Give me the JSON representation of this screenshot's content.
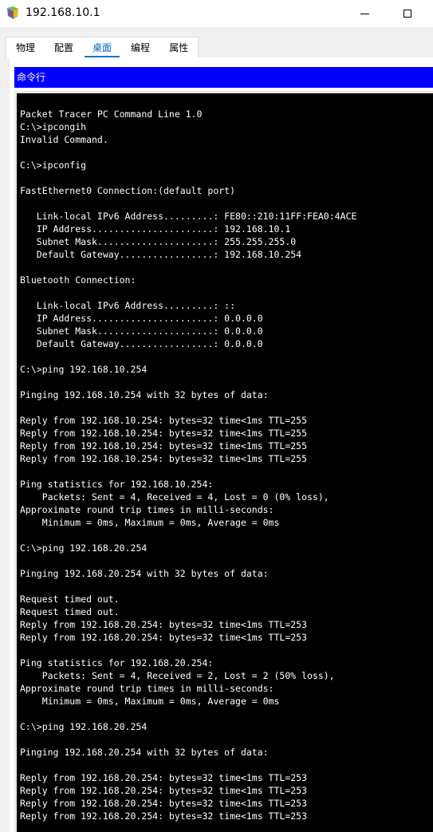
{
  "window": {
    "title": "192.168.10.1",
    "icon": "packet-tracer-icon",
    "min_icon": "minimize-icon",
    "max_icon": "maximize-icon"
  },
  "tabs": [
    {
      "label": "物理"
    },
    {
      "label": "配置"
    },
    {
      "label": "桌面",
      "active": true
    },
    {
      "label": "编程"
    },
    {
      "label": "属性"
    }
  ],
  "command_prompt": {
    "header": "命令行",
    "header_color": "#0000ff",
    "lines": [
      "Packet Tracer PC Command Line 1.0",
      "C:\\>ipcongih",
      "Invalid Command.",
      "",
      "C:\\>ipconfig",
      "",
      "FastEthernet0 Connection:(default port)",
      "",
      "   Link-local IPv6 Address.........: FE80::210:11FF:FEA0:4ACE",
      "   IP Address......................: 192.168.10.1",
      "   Subnet Mask.....................: 255.255.255.0",
      "   Default Gateway.................: 192.168.10.254",
      "",
      "Bluetooth Connection:",
      "",
      "   Link-local IPv6 Address.........: ::",
      "   IP Address......................: 0.0.0.0",
      "   Subnet Mask.....................: 0.0.0.0",
      "   Default Gateway.................: 0.0.0.0",
      "",
      "C:\\>ping 192.168.10.254",
      "",
      "Pinging 192.168.10.254 with 32 bytes of data:",
      "",
      "Reply from 192.168.10.254: bytes=32 time<1ms TTL=255",
      "Reply from 192.168.10.254: bytes=32 time<1ms TTL=255",
      "Reply from 192.168.10.254: bytes=32 time<1ms TTL=255",
      "Reply from 192.168.10.254: bytes=32 time<1ms TTL=255",
      "",
      "Ping statistics for 192.168.10.254:",
      "    Packets: Sent = 4, Received = 4, Lost = 0 (0% loss),",
      "Approximate round trip times in milli-seconds:",
      "    Minimum = 0ms, Maximum = 0ms, Average = 0ms",
      "",
      "C:\\>ping 192.168.20.254",
      "",
      "Pinging 192.168.20.254 with 32 bytes of data:",
      "",
      "Request timed out.",
      "Request timed out.",
      "Reply from 192.168.20.254: bytes=32 time<1ms TTL=253",
      "Reply from 192.168.20.254: bytes=32 time<1ms TTL=253",
      "",
      "Ping statistics for 192.168.20.254:",
      "    Packets: Sent = 4, Received = 2, Lost = 2 (50% loss),",
      "Approximate round trip times in milli-seconds:",
      "    Minimum = 0ms, Maximum = 0ms, Average = 0ms",
      "",
      "C:\\>ping 192.168.20.254",
      "",
      "Pinging 192.168.20.254 with 32 bytes of data:",
      "",
      "Reply from 192.168.20.254: bytes=32 time<1ms TTL=253",
      "Reply from 192.168.20.254: bytes=32 time<1ms TTL=253",
      "Reply from 192.168.20.254: bytes=32 time<1ms TTL=253",
      "Reply from 192.168.20.254: bytes=32 time<1ms TTL=253"
    ]
  }
}
